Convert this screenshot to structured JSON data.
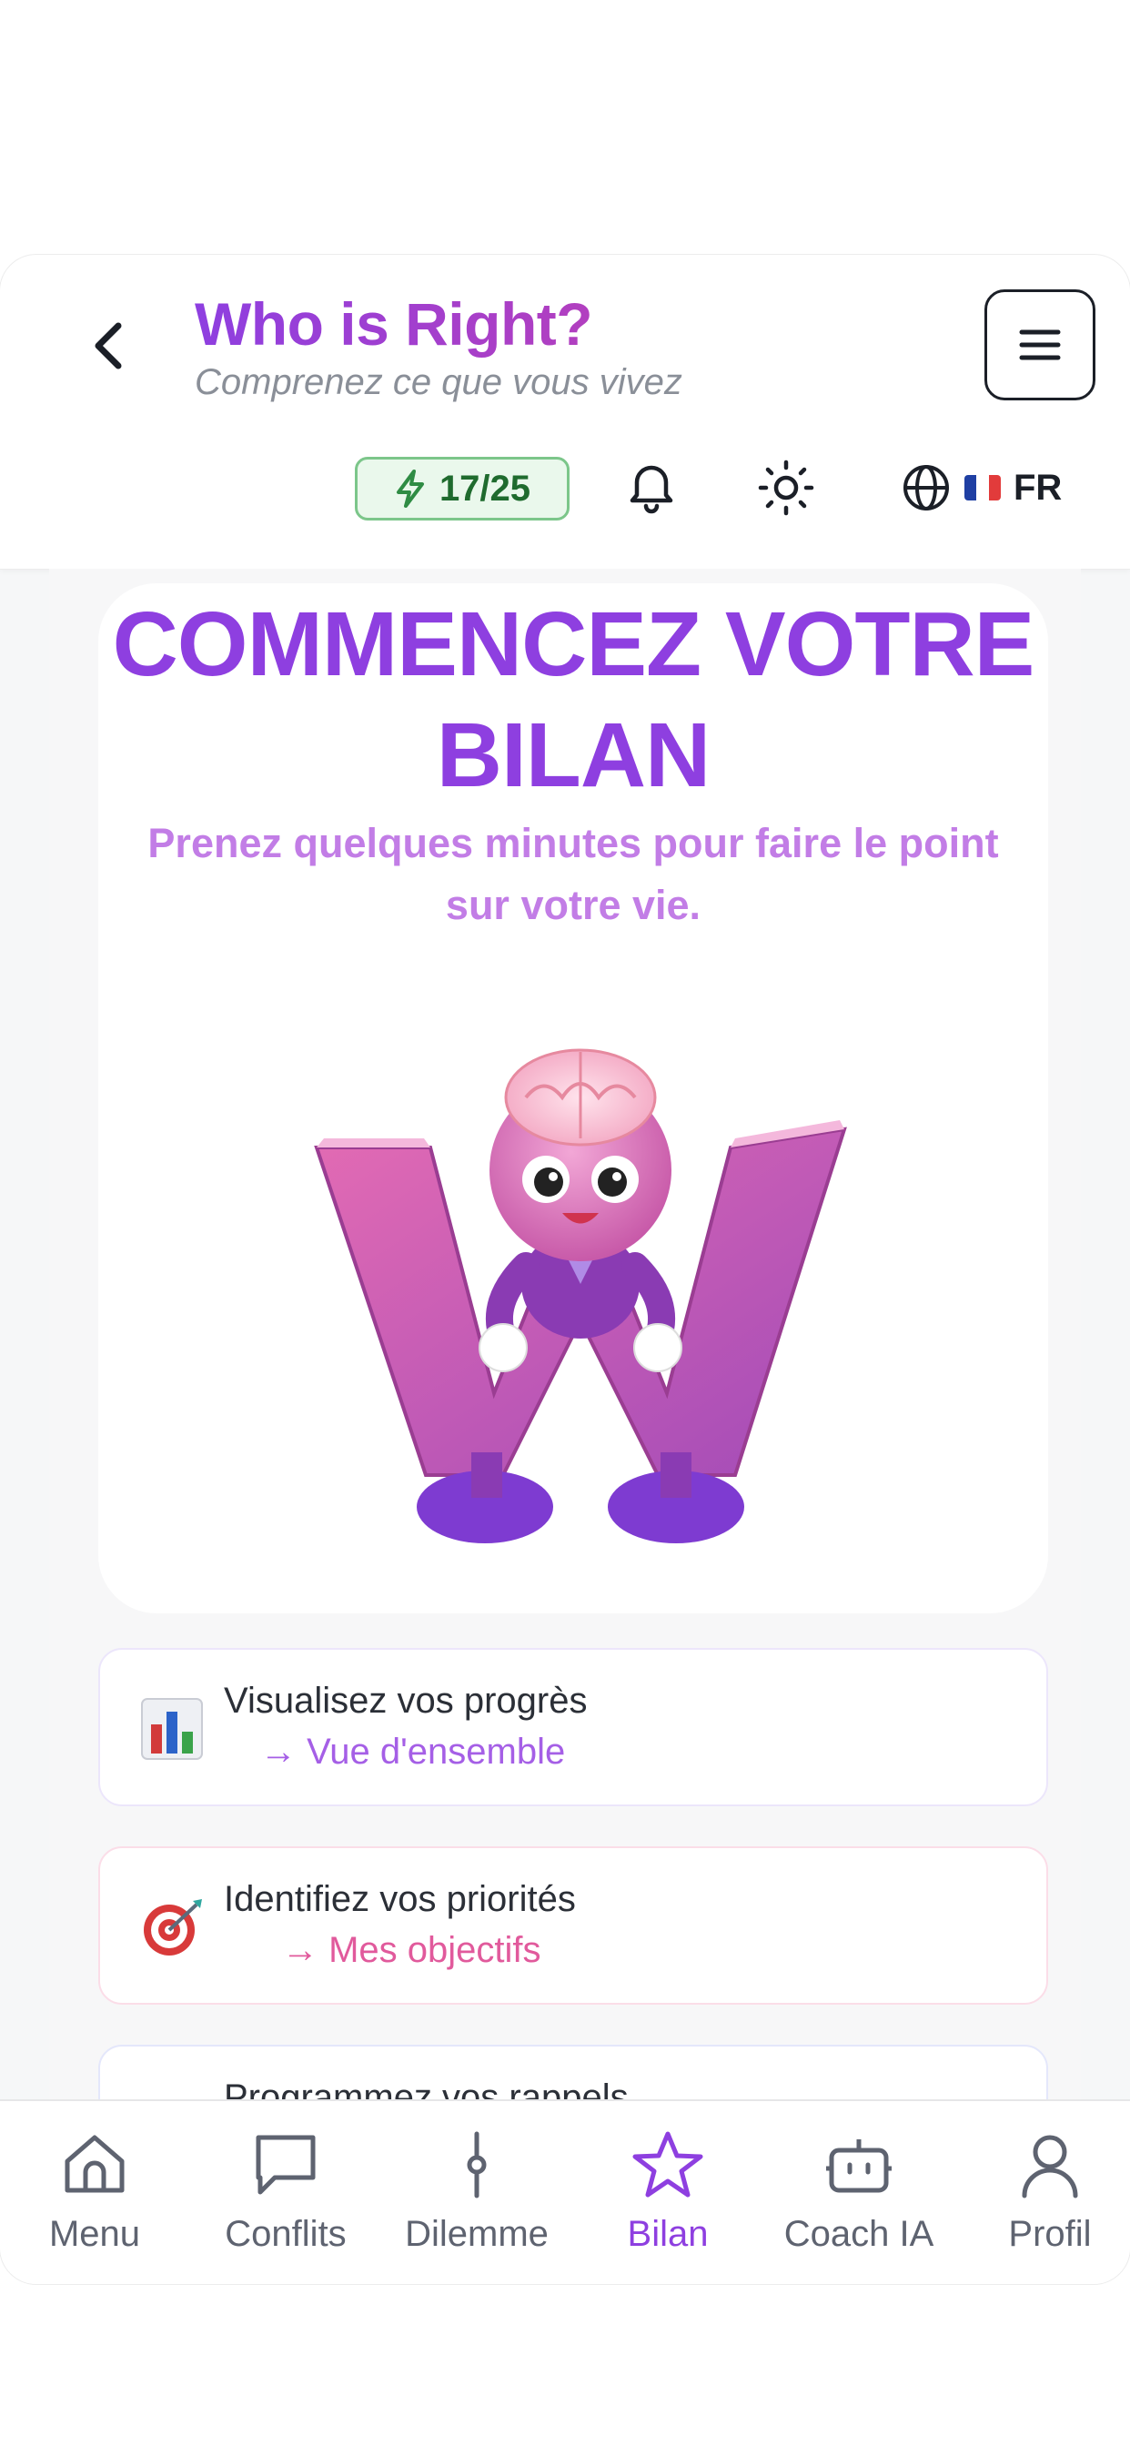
{
  "header": {
    "title": "Who is Right?",
    "subtitle": "Comprenez ce que vous vivez",
    "credits": "17/25",
    "language": "FR",
    "icons": [
      "back-chevron-icon",
      "menu-icon",
      "lightning-icon",
      "bell-icon",
      "sun-icon",
      "globe-icon",
      "flag-fr-icon"
    ]
  },
  "hero": {
    "title_line1": "COMMENCEZ VOTRE",
    "title_line2": "BILAN",
    "subtitle_line1": "Prenez quelques minutes pour faire le point",
    "subtitle_line2": "sur votre vie."
  },
  "features": [
    {
      "title": "Visualisez vos progrès",
      "link": "→ Vue d'ensemble",
      "icon": "bar-chart-icon"
    },
    {
      "title": "Identifiez vos priorités",
      "link": "→ Mes objectifs",
      "icon": "target-icon"
    },
    {
      "title": "Programmez vos rappels"
    }
  ],
  "nav": {
    "items": [
      {
        "label": "Menu",
        "icon": "home-icon"
      },
      {
        "label": "Conflits",
        "icon": "chat-icon"
      },
      {
        "label": "Dilemme",
        "icon": "balance-icon"
      },
      {
        "label": "Bilan",
        "icon": "star-icon",
        "active": true
      },
      {
        "label": "Coach IA",
        "icon": "robot-icon"
      },
      {
        "label": "Profil",
        "icon": "user-icon"
      }
    ]
  },
  "colors": {
    "accent": "#8e3fe0",
    "hero_subtitle": "#c27de6",
    "credit_green": "#1f6b2e",
    "link_purple": "#a55fe6",
    "link_pink": "#e15a9c"
  }
}
